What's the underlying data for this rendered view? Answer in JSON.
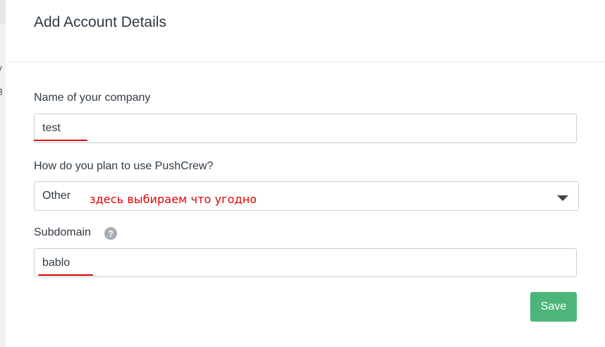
{
  "background": {
    "side_text_1": "v",
    "side_text_2": "3"
  },
  "modal": {
    "title": "Add Account Details",
    "company_label": "Name of your company",
    "company_value": "test",
    "usage_label": "How do you plan to use PushCrew?",
    "usage_selected": "Other",
    "usage_annotation": "здесь выбираем что угодно",
    "subdomain_label": "Subdomain",
    "subdomain_help": "?",
    "subdomain_value": "bablo",
    "save_label": "Save"
  },
  "colors": {
    "accent_green": "#4cb67a",
    "annotation_red": "#e00000",
    "text": "#2f3a45"
  },
  "icons": [
    "help-icon",
    "chevron-down-icon"
  ]
}
